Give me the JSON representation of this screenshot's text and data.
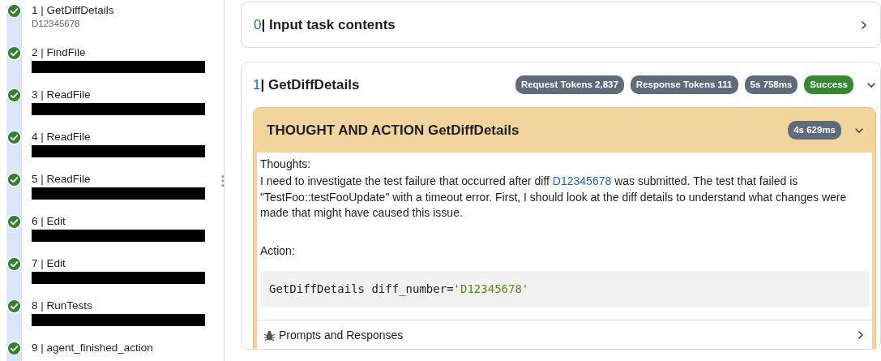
{
  "steps": [
    {
      "title": "1 | GetDiffDetails",
      "completed": true,
      "subtitle": "D12345678",
      "redacted": false
    },
    {
      "title": "2 | FindFile",
      "completed": true,
      "redacted": true
    },
    {
      "title": "3 | ReadFile",
      "completed": true,
      "redacted": true
    },
    {
      "title": "4 | ReadFile",
      "completed": true,
      "redacted": true
    },
    {
      "title": "5 | ReadFile",
      "completed": true,
      "redacted": true
    },
    {
      "title": "6 | Edit",
      "completed": true,
      "redacted": true
    },
    {
      "title": "7 | Edit",
      "completed": true,
      "redacted": true
    },
    {
      "title": "8 | RunTests",
      "completed": true,
      "redacted": true
    },
    {
      "title": "9 | agent_finished_action",
      "completed": true,
      "redacted": false
    }
  ],
  "input_card": {
    "number": "0",
    "title": "| Input task contents",
    "expanded": false
  },
  "step_card": {
    "number": "1",
    "title": "| GetDiffDetails",
    "expanded": true,
    "badges": [
      {
        "label": "Request Tokens 2,837",
        "kind": "secondary"
      },
      {
        "label": "Response Tokens 111",
        "kind": "secondary"
      },
      {
        "label": "5s 758ms",
        "kind": "secondary"
      },
      {
        "label": "Success",
        "kind": "success"
      }
    ],
    "panel": {
      "title": "THOUGHT AND ACTION GetDiffDetails",
      "duration": "4s 629ms",
      "expanded": true,
      "thoughts_label": "Thoughts:",
      "thought": {
        "before": "I need to investigate the test failure that occurred after diff ",
        "link": "D12345678",
        "after": " was submitted. The test that failed is \"TestFoo::testFooUpdate\" with a timeout error. First, I should look at the diff details to understand what changes were made that might have caused this issue."
      },
      "action_label": "Action:",
      "code": {
        "command": "GetDiffDetails diff_number=",
        "argument": "'D12345678'"
      },
      "prompts_label": "Prompts and Responses"
    }
  }
}
